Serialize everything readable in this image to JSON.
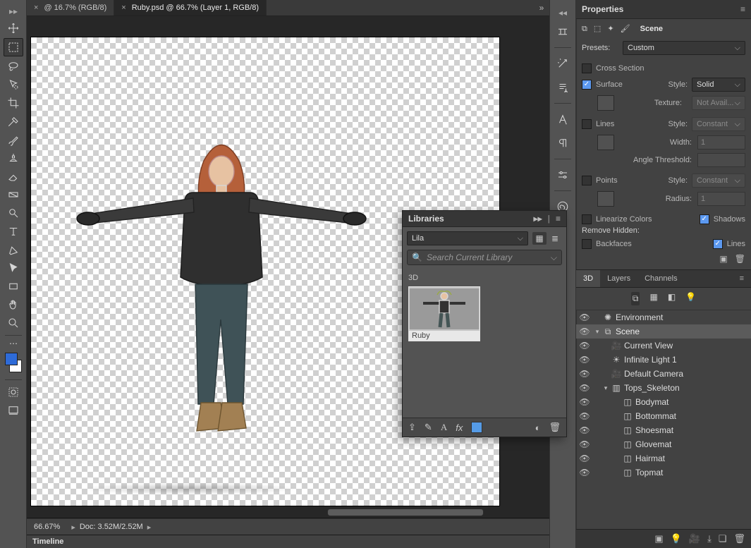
{
  "tabs": {
    "inactive_label": "@ 16.7% (RGB/8)",
    "active_label": "Ruby.psd @ 66.7% (Layer 1, RGB/8)"
  },
  "status": {
    "zoom": "66.67%",
    "doc_info": "Doc: 3.52M/2.52M"
  },
  "timeline_label": "Timeline",
  "properties": {
    "title": "Properties",
    "scene_label": "Scene",
    "presets_label": "Presets:",
    "presets_value": "Custom",
    "cross_section_label": "Cross Section",
    "cross_section_checked": false,
    "surface_label": "Surface",
    "surface_checked": true,
    "style_label": "Style:",
    "surface_style_value": "Solid",
    "texture_label": "Texture:",
    "texture_value": "Not Avail...",
    "lines_label": "Lines",
    "lines_checked": false,
    "lines_style_value": "Constant",
    "width_label": "Width:",
    "width_value": "1",
    "angle_label": "Angle Threshold:",
    "points_label": "Points",
    "points_checked": false,
    "points_style_value": "Constant",
    "radius_label": "Radius:",
    "radius_value": "1",
    "linearize_label": "Linearize Colors",
    "linearize_checked": false,
    "shadows_label": "Shadows",
    "shadows_checked": true,
    "remove_hidden_label": "Remove Hidden:",
    "backfaces_label": "Backfaces",
    "backfaces_checked": false,
    "lines2_label": "Lines",
    "lines2_checked": true
  },
  "panel_tabs": {
    "t3d": "3D",
    "layers": "Layers",
    "channels": "Channels"
  },
  "tree": {
    "environment": "Environment",
    "scene": "Scene",
    "current_view": "Current View",
    "infinite_light": "Infinite Light 1",
    "default_camera": "Default Camera",
    "skeleton": "Tops_Skeleton",
    "bodymat": "Bodymat",
    "bottommat": "Bottommat",
    "shoesmat": "Shoesmat",
    "glovemat": "Glovemat",
    "hairmat": "Hairmat",
    "topmat": "Topmat"
  },
  "libraries": {
    "title": "Libraries",
    "select_value": "Lila",
    "search_placeholder": "Search Current Library",
    "section_label": "3D",
    "item_label": "Ruby"
  }
}
